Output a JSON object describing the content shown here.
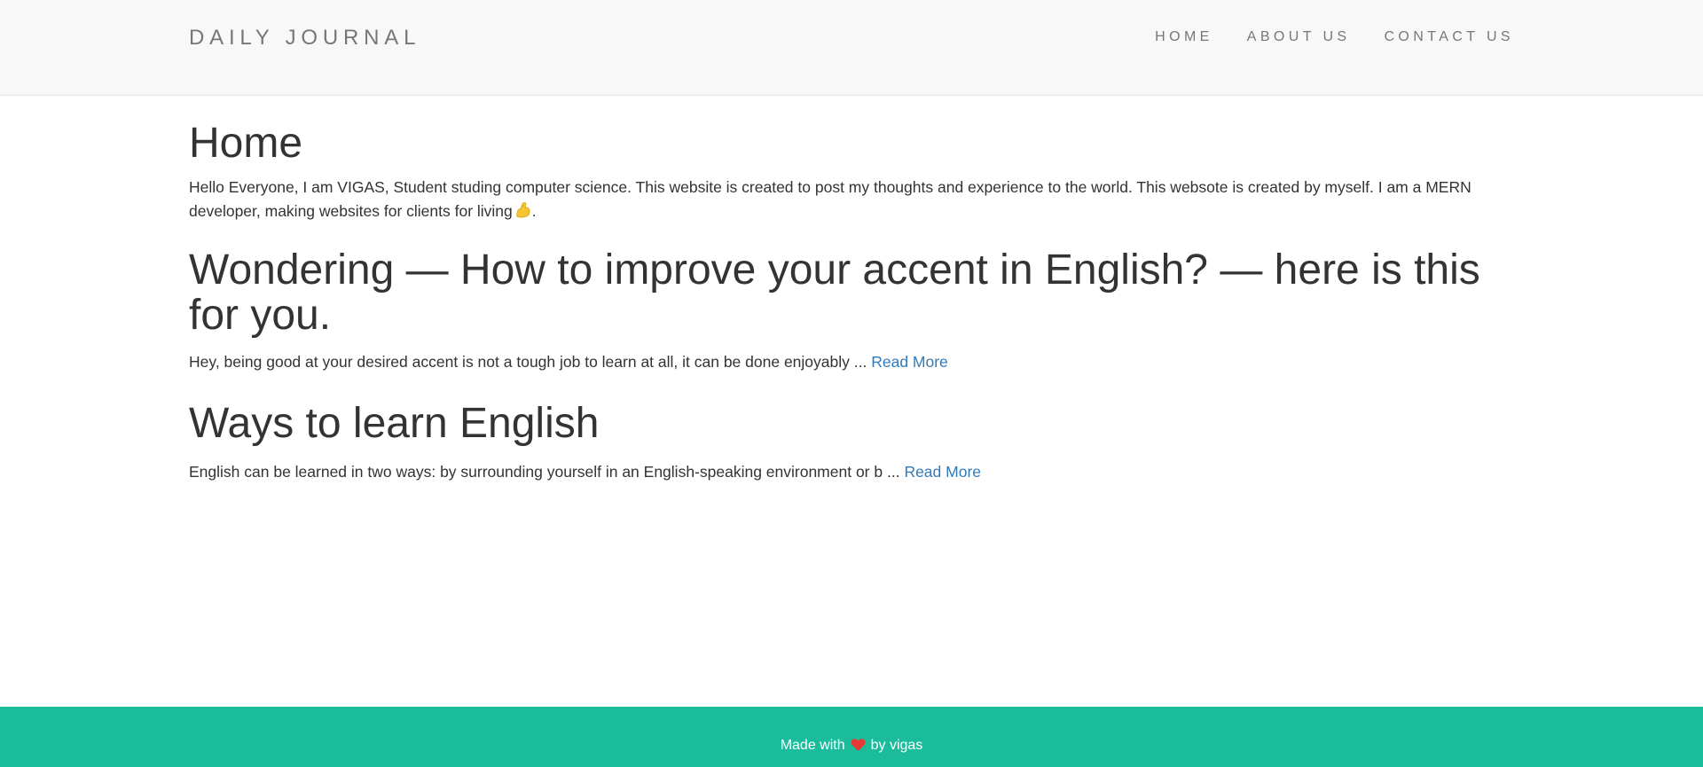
{
  "header": {
    "brand": "DAILY JOURNAL",
    "nav": [
      {
        "label": "HOME"
      },
      {
        "label": "ABOUT US"
      },
      {
        "label": "CONTACT US"
      }
    ]
  },
  "main": {
    "title": "Home",
    "intro": "Hello Everyone, I am VIGAS, Student studing computer science. This website is created to post my thoughts and experience to the world. This websote is created by myself. I am a MERN developer, making websites for clients for living",
    "intro_end": ".",
    "intro_emoji_icon": "flexed-biceps-icon",
    "posts": [
      {
        "title": "Wondering — How to improve your accent in English? — here is this for you.",
        "excerpt": "Hey, being good at your desired accent is not a tough job to learn at all, it can be done enjoyably ...",
        "read_more": "Read More"
      },
      {
        "title": "Ways to learn English",
        "excerpt": "English can be learned in two ways: by surrounding yourself in an English-speaking environment or b ...",
        "read_more": "Read More"
      }
    ]
  },
  "footer": {
    "prefix": "Made with",
    "icon": "heart-icon",
    "suffix": "by vigas"
  },
  "colors": {
    "navbar_bg": "#f8f8f8",
    "footer_bg": "#1abc9c",
    "link": "#337ab7",
    "heart": "#e53935"
  }
}
